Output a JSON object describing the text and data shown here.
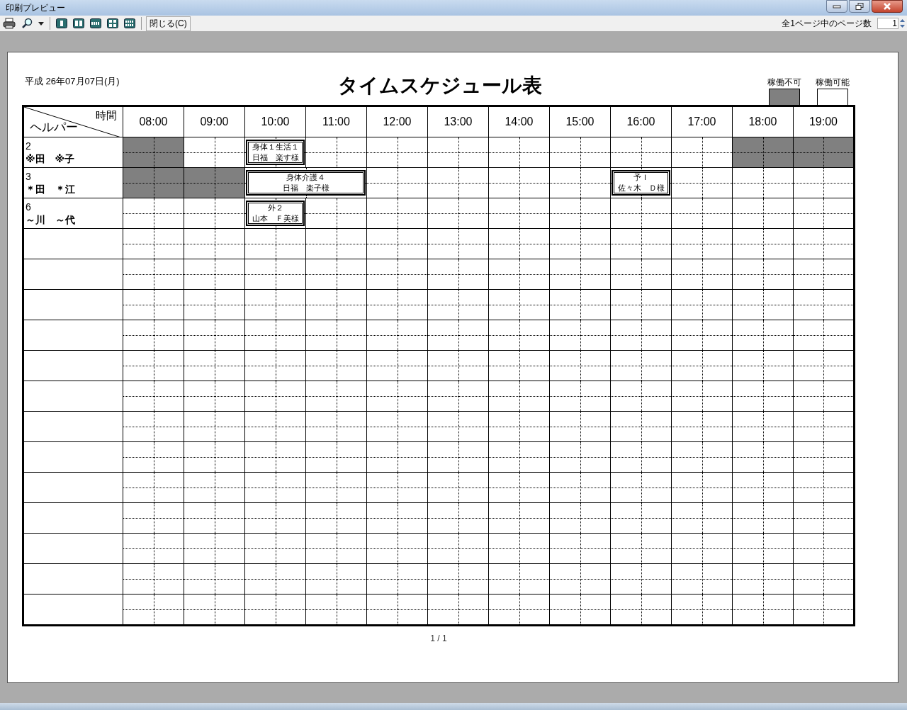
{
  "window": {
    "title": "印刷プレビュー"
  },
  "toolbar": {
    "close_button": "閉じる(C)",
    "page_count_label": "全1ページ中のページ数",
    "page_number": "1"
  },
  "page": {
    "date": "平成 26年07月07日(月)",
    "title": "タイムスケジュール表",
    "legend": [
      {
        "label": "稼働不可",
        "color": "#808080"
      },
      {
        "label": "稼働可能",
        "color": "#ffffff"
      }
    ],
    "corner": {
      "top": "時間",
      "bottom": "ヘルパー"
    },
    "hours": [
      "08:00",
      "09:00",
      "10:00",
      "11:00",
      "12:00",
      "13:00",
      "14:00",
      "15:00",
      "16:00",
      "17:00",
      "18:00",
      "19:00"
    ],
    "rows": [
      {
        "number": "2",
        "name": "※田　※子",
        "cells": [
          {
            "kind": "blocked"
          },
          {
            "kind": "free"
          },
          {
            "kind": "visit",
            "lines": [
              "身体１生活１",
              "日福　楽す様"
            ]
          },
          {
            "kind": "free"
          },
          {
            "kind": "free"
          },
          {
            "kind": "free"
          },
          {
            "kind": "free"
          },
          {
            "kind": "free"
          },
          {
            "kind": "free"
          },
          {
            "kind": "free"
          },
          {
            "kind": "blocked"
          },
          {
            "kind": "blocked"
          }
        ]
      },
      {
        "number": "3",
        "name": "＊田　＊江",
        "cells": [
          {
            "kind": "blocked"
          },
          {
            "kind": "blocked"
          },
          {
            "kind": "visit",
            "lines": [
              "身体介護４",
              "日福　楽子様"
            ]
          },
          {
            "kind": "continued"
          },
          {
            "kind": "free"
          },
          {
            "kind": "free"
          },
          {
            "kind": "free"
          },
          {
            "kind": "free"
          },
          {
            "kind": "visit",
            "lines": [
              "予Ｉ",
              "佐々木　Ｄ様"
            ]
          },
          {
            "kind": "free"
          },
          {
            "kind": "free"
          },
          {
            "kind": "free"
          }
        ]
      },
      {
        "number": "6",
        "name": "～川　～代",
        "cells": [
          {
            "kind": "free"
          },
          {
            "kind": "free"
          },
          {
            "kind": "visit",
            "lines": [
              "外２",
              "山本　Ｆ美様"
            ]
          },
          {
            "kind": "free"
          },
          {
            "kind": "free"
          },
          {
            "kind": "free"
          },
          {
            "kind": "free"
          },
          {
            "kind": "free"
          },
          {
            "kind": "free"
          },
          {
            "kind": "free"
          },
          {
            "kind": "free"
          },
          {
            "kind": "free"
          }
        ]
      }
    ],
    "footer": "1 / 1"
  }
}
